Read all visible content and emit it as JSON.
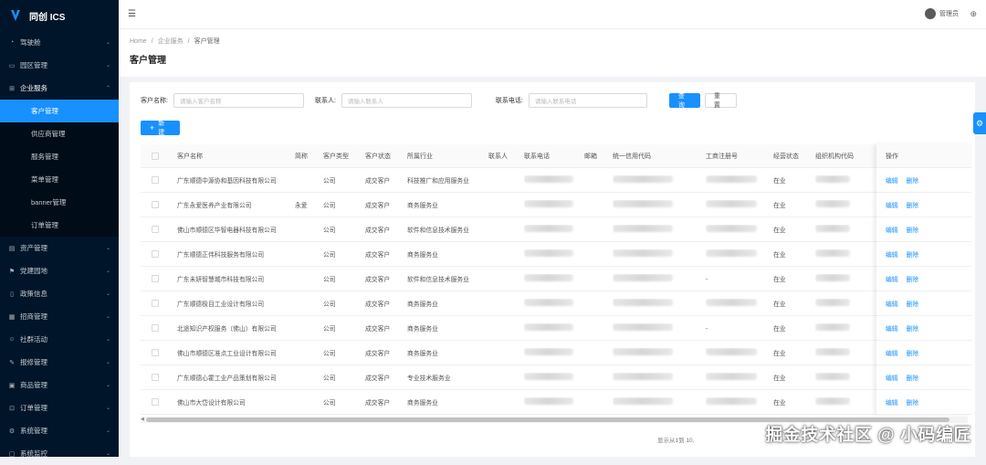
{
  "app": {
    "title": "同创 ICS"
  },
  "sidebar": {
    "items": [
      {
        "label": "驾驶舱",
        "icon": "dashboard-icon"
      },
      {
        "label": "园区管理",
        "icon": "building-icon"
      },
      {
        "label": "企业服务",
        "icon": "grid-icon",
        "open": true,
        "children": [
          {
            "label": "客户管理",
            "active": true
          },
          {
            "label": "供应商管理"
          },
          {
            "label": "服务管理"
          },
          {
            "label": "菜单管理"
          },
          {
            "label": "banner管理"
          },
          {
            "label": "订单管理"
          }
        ]
      },
      {
        "label": "资产管理",
        "icon": "asset-icon"
      },
      {
        "label": "党建园地",
        "icon": "flag-icon"
      },
      {
        "label": "政策信息",
        "icon": "document-icon"
      },
      {
        "label": "招商管理",
        "icon": "briefcase-icon"
      },
      {
        "label": "社群活动",
        "icon": "people-icon"
      },
      {
        "label": "报修管理",
        "icon": "wrench-icon"
      },
      {
        "label": "商品管理",
        "icon": "box-icon"
      },
      {
        "label": "订单管理",
        "icon": "cart-icon"
      },
      {
        "label": "系统管理",
        "icon": "gear-icon"
      },
      {
        "label": "系统监控",
        "icon": "monitor-icon"
      }
    ]
  },
  "header": {
    "user": "管理员"
  },
  "breadcrumb": [
    "Home",
    "企业服务",
    "客户管理"
  ],
  "page_title": "客户管理",
  "filters": {
    "customer_name_label": "客户名称:",
    "customer_name_placeholder": "请输入客户名称",
    "contact_label": "联系人:",
    "contact_placeholder": "请输入联系人",
    "phone_label": "联系电话:",
    "phone_placeholder": "请输入联系电话",
    "search_label": "查 询",
    "reset_label": "重 置"
  },
  "add_button": "新建",
  "table": {
    "columns": [
      "客户名称",
      "简称",
      "客户类型",
      "客户状态",
      "所属行业",
      "联系人",
      "联系电话",
      "邮箱",
      "统一信用代码",
      "工商注册号",
      "经营状态",
      "组织机构代码",
      "操作"
    ],
    "edit_label": "编辑",
    "delete_label": "删除",
    "rows": [
      {
        "name": "广东顺德中源协和基因科技有限公司",
        "short": "",
        "type": "公司",
        "status": "成交客户",
        "industry": "科技推广和应用服务业",
        "reg": "",
        "biz": "在业"
      },
      {
        "name": "广东永爱医养产业有限公司",
        "short": "永爱",
        "type": "公司",
        "status": "成交客户",
        "industry": "商务服务业",
        "reg": "",
        "biz": "在业"
      },
      {
        "name": "佛山市顺德区华智电器科技有限公司",
        "short": "",
        "type": "公司",
        "status": "成交客户",
        "industry": "软件和信息技术服务业",
        "reg": "",
        "biz": "在业"
      },
      {
        "name": "广东顺德正伟科技服务有限公司",
        "short": "",
        "type": "公司",
        "status": "成交客户",
        "industry": "商务服务业",
        "reg": "",
        "biz": "在业"
      },
      {
        "name": "广东未妍智慧城市科技有限公司",
        "short": "",
        "type": "公司",
        "status": "成交客户",
        "industry": "软件和信息技术服务业",
        "reg": "-",
        "biz": "在业"
      },
      {
        "name": "广东顺德极目工业设计有限公司",
        "short": "",
        "type": "公司",
        "status": "成交客户",
        "industry": "商务服务业",
        "reg": "",
        "biz": "在业"
      },
      {
        "name": "北途知识产权服务（佛山）有限公司",
        "short": "",
        "type": "公司",
        "status": "成交客户",
        "industry": "商务服务业",
        "reg": "-",
        "biz": "在业"
      },
      {
        "name": "佛山市顺德区准点工业设计有限公司",
        "short": "",
        "type": "公司",
        "status": "成交客户",
        "industry": "商务服务业",
        "reg": "",
        "biz": "在业"
      },
      {
        "name": "广东顺德心霍工业产品策划有限公司",
        "short": "",
        "type": "公司",
        "status": "成交客户",
        "industry": "专业技术服务业",
        "reg": "",
        "biz": "在业"
      },
      {
        "name": "佛山市大岱设计有限公司",
        "short": "",
        "type": "公司",
        "status": "成交客户",
        "industry": "商务服务业",
        "reg": "",
        "biz": "在业"
      }
    ]
  },
  "pagination": {
    "text": "显示从1到 10,"
  },
  "watermark": "掘金技术社区 @ 小码编匠"
}
